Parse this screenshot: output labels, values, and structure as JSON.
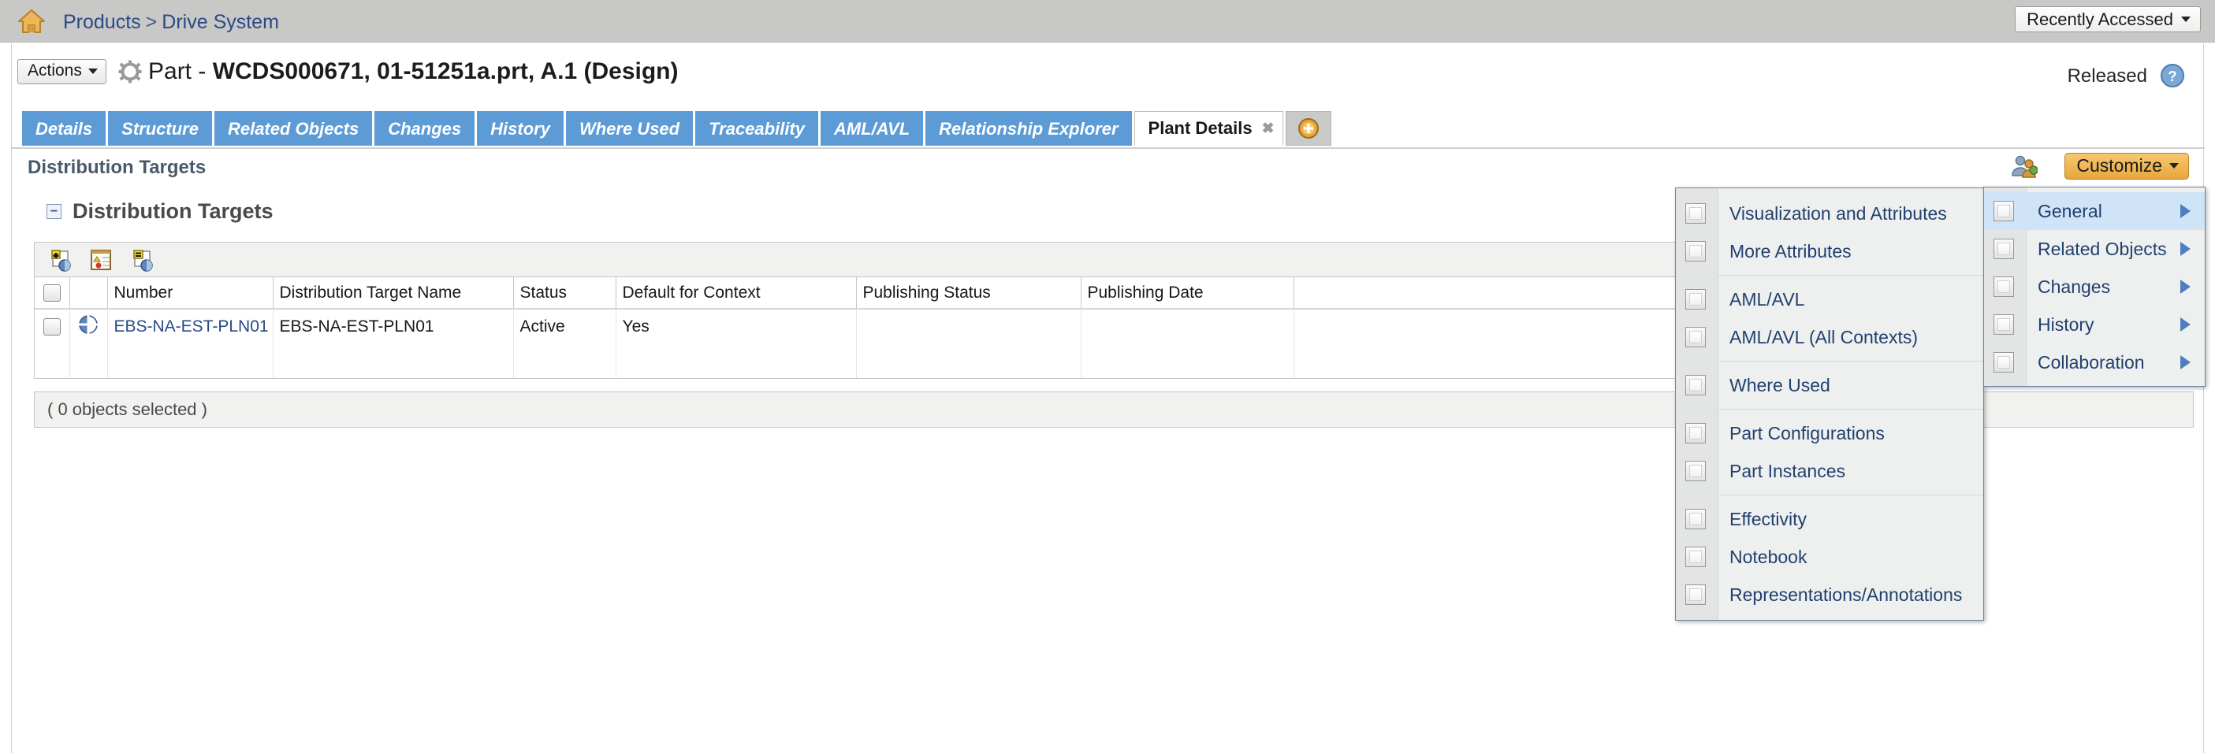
{
  "topbar": {
    "home_icon": "home-icon",
    "breadcrumb": {
      "root": "Products",
      "separator": ">",
      "current": "Drive System"
    },
    "recently_accessed": "Recently Accessed"
  },
  "object_header": {
    "actions_label": "Actions",
    "type_label": "Part - ",
    "object_title": "WCDS000671, 01-51251a.prt, A.1 (Design)",
    "state": "Released",
    "help_icon": "help-icon"
  },
  "tabs": [
    {
      "label": "Details",
      "active": false
    },
    {
      "label": "Structure",
      "active": false
    },
    {
      "label": "Related Objects",
      "active": false
    },
    {
      "label": "Changes",
      "active": false
    },
    {
      "label": "History",
      "active": false
    },
    {
      "label": "Where Used",
      "active": false
    },
    {
      "label": "Traceability",
      "active": false
    },
    {
      "label": "AML/AVL",
      "active": false
    },
    {
      "label": "Relationship Explorer",
      "active": false
    },
    {
      "label": "Plant Details",
      "active": true
    }
  ],
  "tab_add_icon": "add-tab-icon",
  "section": {
    "label": "Distribution Targets",
    "people_icon": "people-icon",
    "customize_label": "Customize"
  },
  "panel": {
    "title": "Distribution Targets",
    "toolbar_icons": [
      "add-distribution-target-icon",
      "edit-distribution-target-icon",
      "remove-distribution-target-icon"
    ],
    "columns": [
      "Number",
      "Distribution Target Name",
      "Status",
      "Default for Context",
      "Publishing Status",
      "Publishing Date",
      ""
    ],
    "rows": [
      {
        "number": "EBS-NA-EST-PLN01",
        "name": "EBS-NA-EST-PLN01",
        "status": "Active",
        "default_for_context": "Yes",
        "publishing_status": "",
        "publishing_date": "",
        "extra": ""
      }
    ],
    "selection_status": "( 0 objects selected )"
  },
  "customize_menu": {
    "items": [
      {
        "label": "General",
        "highlighted": true,
        "has_submenu": true
      },
      {
        "label": "Related Objects",
        "highlighted": false,
        "has_submenu": true
      },
      {
        "label": "Changes",
        "highlighted": false,
        "has_submenu": true
      },
      {
        "label": "History",
        "highlighted": false,
        "has_submenu": true
      },
      {
        "label": "Collaboration",
        "highlighted": false,
        "has_submenu": true
      }
    ]
  },
  "general_submenu": {
    "groups": [
      {
        "items": [
          {
            "label": "Visualization and Attributes"
          },
          {
            "label": "More Attributes"
          }
        ]
      },
      {
        "items": [
          {
            "label": "AML/AVL"
          },
          {
            "label": "AML/AVL (All Contexts)"
          }
        ]
      },
      {
        "items": [
          {
            "label": "Where Used"
          }
        ]
      },
      {
        "items": [
          {
            "label": "Part Configurations"
          },
          {
            "label": "Part Instances"
          }
        ]
      },
      {
        "items": [
          {
            "label": "Effectivity"
          },
          {
            "label": "Notebook"
          },
          {
            "label": "Representations/Annotations"
          }
        ]
      }
    ]
  },
  "colors": {
    "tab_blue": "#5c9bd6",
    "link_blue": "#2a4a86",
    "customize_orange": "#e8a63c",
    "menu_highlight": "#cfe4f7",
    "topbar_gray": "#c8c8c6"
  }
}
